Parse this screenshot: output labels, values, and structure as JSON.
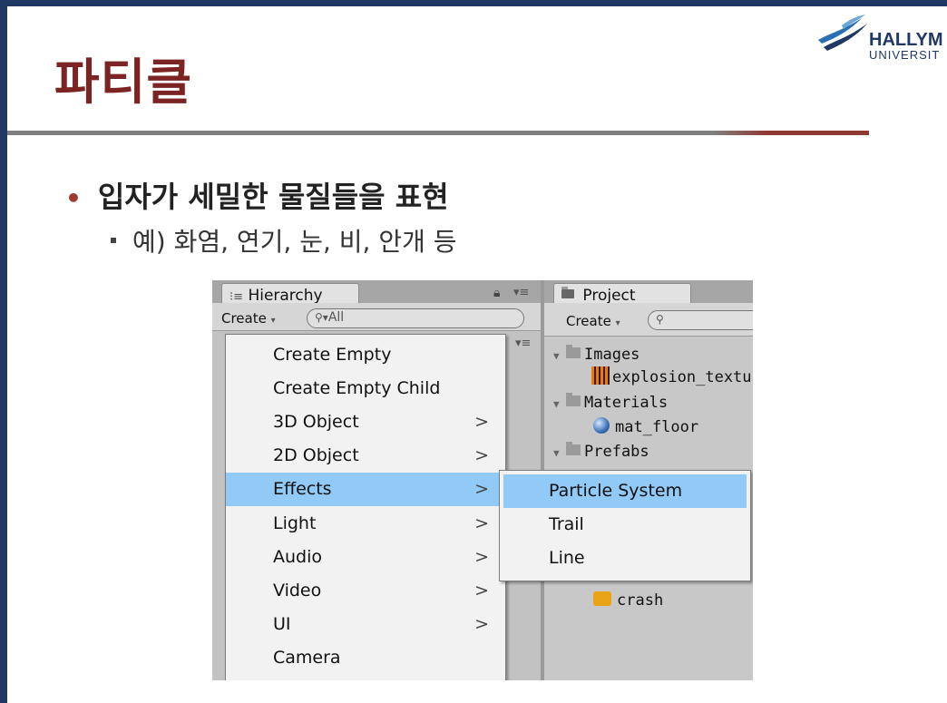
{
  "slide": {
    "title": "파티클",
    "logo_name": "HALLYM",
    "logo_sub": "UNIVERSIT",
    "bullet_main": "입자가 세밀한 물질들을 표현",
    "bullet_sub": "예) 화염, 연기, 눈, 비, 안개 등"
  },
  "hierarchy": {
    "tab_label": "Hierarchy",
    "create_label": "Create",
    "search_placeholder": "All"
  },
  "project": {
    "tab_label": "Project",
    "create_label": "Create",
    "tree": {
      "images": "Images",
      "explosion": "explosion_textu",
      "materials": "Materials",
      "mat_floor": "mat_floor",
      "prefabs": "Prefabs",
      "crash": "crash"
    }
  },
  "create_menu": {
    "items": [
      {
        "label": "Create Empty",
        "arrow": ""
      },
      {
        "label": "Create Empty Child",
        "arrow": ""
      },
      {
        "label": "3D Object",
        "arrow": ">"
      },
      {
        "label": "2D Object",
        "arrow": ">"
      },
      {
        "label": "Effects",
        "arrow": ">"
      },
      {
        "label": "Light",
        "arrow": ">"
      },
      {
        "label": "Audio",
        "arrow": ">"
      },
      {
        "label": "Video",
        "arrow": ">"
      },
      {
        "label": "UI",
        "arrow": ">"
      },
      {
        "label": "Camera",
        "arrow": ""
      }
    ],
    "highlighted": "Effects"
  },
  "effects_submenu": {
    "items": [
      {
        "label": "Particle System"
      },
      {
        "label": "Trail"
      },
      {
        "label": "Line"
      }
    ],
    "highlighted": "Particle System"
  },
  "colors": {
    "title": "#7b2423",
    "frame": "#1f3864",
    "menu_highlight": "#91c9f7"
  },
  "icons": [
    "hierarchy-list-icon",
    "lock-icon",
    "panel-menu-icon",
    "folder-icon",
    "search-icon",
    "texture-icon",
    "material-sphere-icon",
    "audio-clip-icon"
  ]
}
